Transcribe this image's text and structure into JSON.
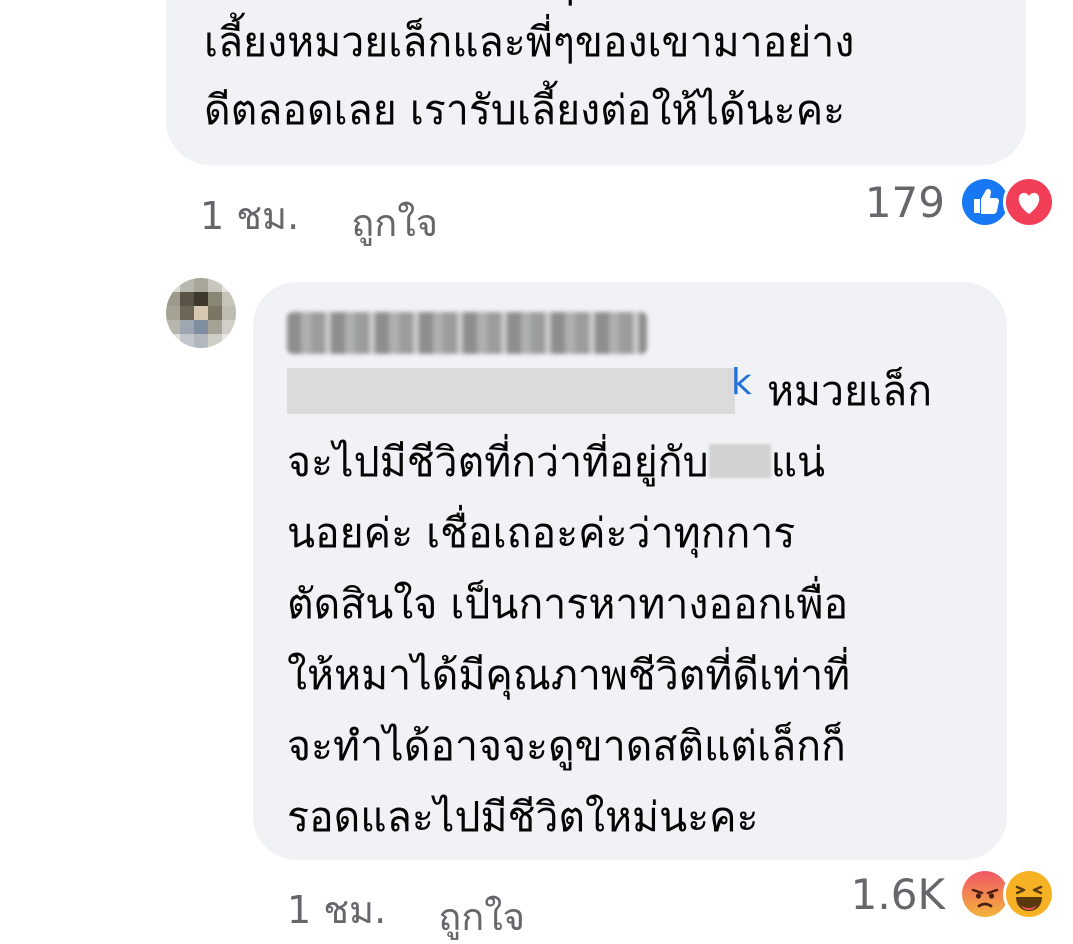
{
  "comment_1": {
    "lines": [
      "เลี้ยงหมวยเล็กและพี่ๆของเขามาอย่าง",
      "ดีตลอดเลย เรารับเลี้ยงต่อให้ได้นะคะ"
    ],
    "partial_line": "เลี้ยงหมวยเล็กและพี่ๆของเขามาอย่าง",
    "time": "1 ชม.",
    "like_label": "ถูกใจ",
    "reaction_count": "179",
    "reactions": [
      "like-icon",
      "love-icon"
    ],
    "colors": {
      "like": "#1877f2",
      "love": "#f33e58"
    }
  },
  "comment_2": {
    "mention_tail": "k",
    "lines": [
      "หมวยเล็ก",
      "จะไปมีชีวิตที่กว่าที่อยู่กับ",
      "แน่",
      "นอยค่ะ เชื่อเถอะค่ะว่าทุกการ",
      "ตัดสินใจ เป็นการหาทางออกเพื่อ",
      "ให้หมาได้มีคุณภาพชีวิตที่ดีเท่าที่",
      "จะทำได้อาจจะดูขาดสติแต่เล็กก็",
      "รอดและไปมีชีวิตใหม่นะคะ"
    ],
    "time": "1 ชม.",
    "like_label": "ถูกใจ",
    "reaction_count": "1.6K",
    "reactions": [
      "angry-icon",
      "haha-icon"
    ],
    "colors": {
      "angry": "#e9710f",
      "haha": "#f7b125"
    }
  }
}
